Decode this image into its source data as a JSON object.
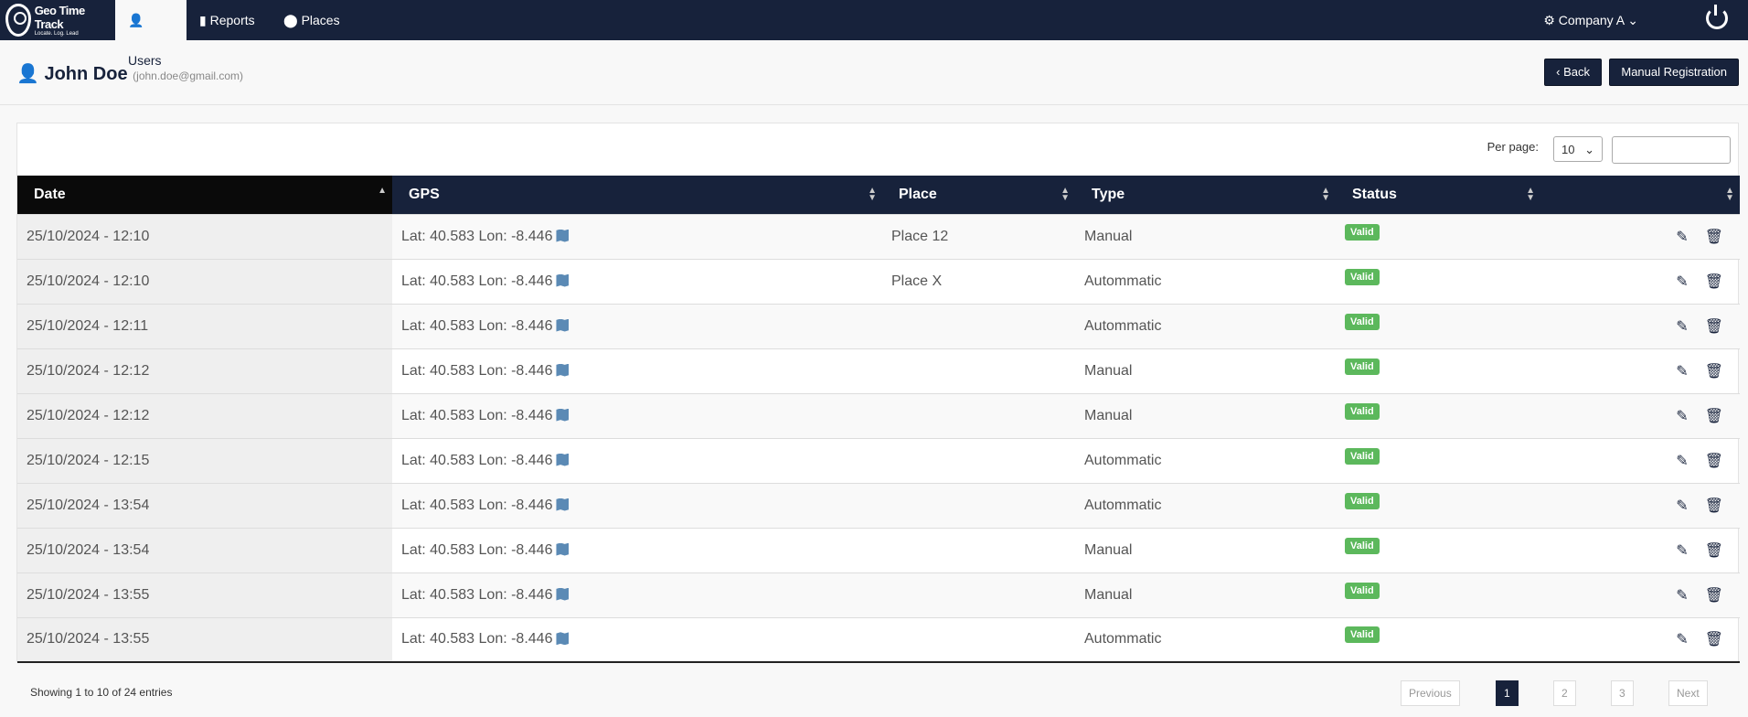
{
  "nav": {
    "logo_title": "Geo Time Track",
    "logo_tagline": "Locate. Log. Lead",
    "items": [
      {
        "label": "Users",
        "icon": "user-icon",
        "active": true
      },
      {
        "label": "Reports",
        "icon": "file-icon"
      },
      {
        "label": "Places",
        "icon": "map-marker-icon"
      }
    ],
    "company": "Company A",
    "brand_color": "#17223b"
  },
  "header": {
    "name": "John Doe",
    "email": "(john.doe@gmail.com)",
    "back": "‹ Back",
    "manual": "Manual Registration"
  },
  "controls": {
    "per_page_label": "Per page:",
    "per_page": "10",
    "search_value": ""
  },
  "table": {
    "columns": [
      "Date",
      "GPS",
      "Place",
      "Type",
      "Status",
      ""
    ],
    "rows": [
      {
        "date": "25/10/2024 - 12:10",
        "gps": "Lat: 40.583 Lon: -8.446",
        "place": "Place 12",
        "type": "Manual",
        "status": "Valid"
      },
      {
        "date": "25/10/2024 - 12:10",
        "gps": "Lat: 40.583 Lon: -8.446",
        "place": "Place X",
        "type": "Autommatic",
        "status": "Valid"
      },
      {
        "date": "25/10/2024 - 12:11",
        "gps": "Lat: 40.583 Lon: -8.446",
        "place": "",
        "type": "Autommatic",
        "status": "Valid"
      },
      {
        "date": "25/10/2024 - 12:12",
        "gps": "Lat: 40.583 Lon: -8.446",
        "place": "",
        "type": "Manual",
        "status": "Valid"
      },
      {
        "date": "25/10/2024 - 12:12",
        "gps": "Lat: 40.583 Lon: -8.446",
        "place": "",
        "type": "Manual",
        "status": "Valid"
      },
      {
        "date": "25/10/2024 - 12:15",
        "gps": "Lat: 40.583 Lon: -8.446",
        "place": "",
        "type": "Autommatic",
        "status": "Valid"
      },
      {
        "date": "25/10/2024 - 13:54",
        "gps": "Lat: 40.583 Lon: -8.446",
        "place": "",
        "type": "Autommatic",
        "status": "Valid"
      },
      {
        "date": "25/10/2024 - 13:54",
        "gps": "Lat: 40.583 Lon: -8.446",
        "place": "",
        "type": "Manual",
        "status": "Valid"
      },
      {
        "date": "25/10/2024 - 13:55",
        "gps": "Lat: 40.583 Lon: -8.446",
        "place": "",
        "type": "Manual",
        "status": "Valid"
      },
      {
        "date": "25/10/2024 - 13:55",
        "gps": "Lat: 40.583 Lon: -8.446",
        "place": "",
        "type": "Autommatic",
        "status": "Valid"
      }
    ]
  },
  "footer": {
    "info": "Showing 1 to 10 of 24 entries",
    "pages": [
      "Previous",
      "1",
      "2",
      "3",
      "Next"
    ],
    "current": "1"
  }
}
